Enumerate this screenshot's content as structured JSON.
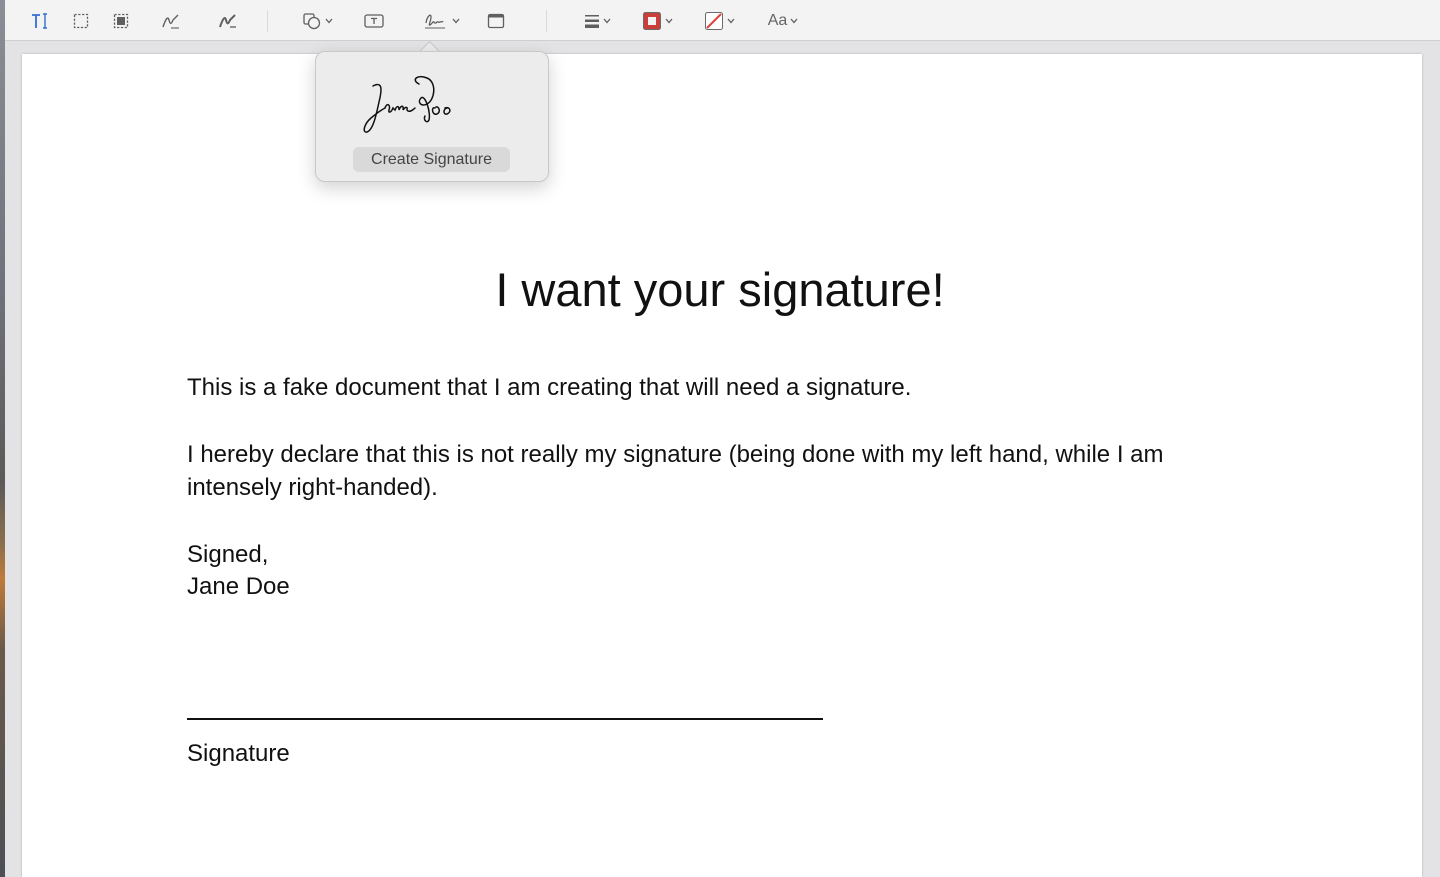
{
  "toolbar": {
    "icons": [
      "text-selection-icon",
      "rectangular-selection-icon",
      "redact-icon",
      "sketch-icon",
      "draw-icon",
      "shapes-icon",
      "text-box-icon",
      "signature-icon",
      "note-icon",
      "shape-style-icon",
      "border-color-icon",
      "fill-color-icon",
      "text-style-icon"
    ],
    "text_style_label": "Aa",
    "accent_color": "#2f6fd6",
    "border_color": "#c9403a",
    "fill_color": "#e0433b"
  },
  "signature_popover": {
    "create_label": "Create Signature",
    "signature_image": "Jane Doe"
  },
  "document": {
    "title": "I want your signature!",
    "paragraph1": "This is a fake document that I am creating that will need a signature.",
    "paragraph2": "I hereby declare that this is not really my signature (being done with my left hand, while I am intensely right-handed).",
    "signed_label": "Signed,",
    "signer_name": "Jane Doe",
    "signature_caption": "Signature"
  }
}
